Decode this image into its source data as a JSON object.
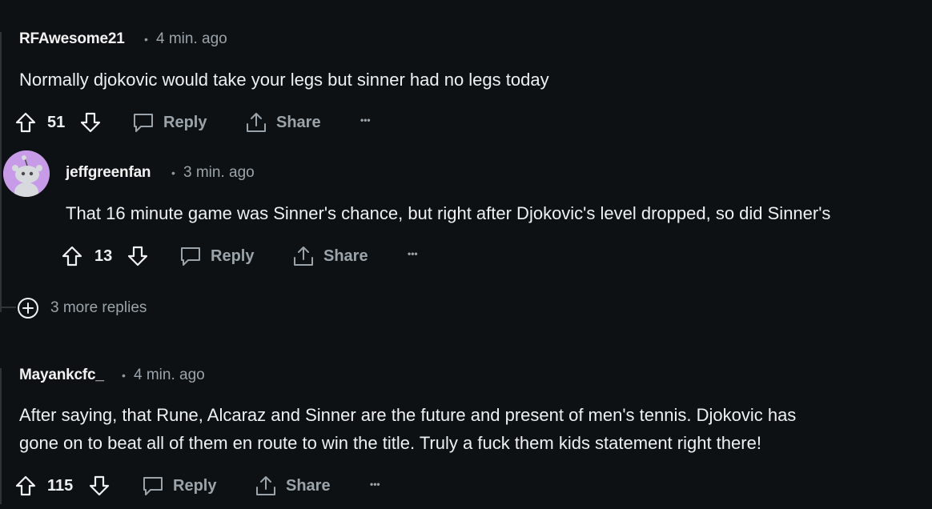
{
  "comments": [
    {
      "author": "RFAwesome21",
      "separator": "•",
      "time": "4 min. ago",
      "body": [
        "Normally djokovic would take your legs but sinner had no legs today"
      ],
      "score": "51",
      "reply_label": "Reply",
      "share_label": "Share",
      "more_label": "•••"
    },
    {
      "author": "jeffgreenfan",
      "separator": "•",
      "time": "3 min. ago",
      "body": [
        "That 16 minute game was Sinner's chance, but right after Djokovic's level dropped, so did Sinner's"
      ],
      "score": "13",
      "reply_label": "Reply",
      "share_label": "Share",
      "more_label": "•••"
    },
    {
      "author": "Mayankcfc_",
      "separator": "•",
      "time": "4 min. ago",
      "body": [
        "After saying, that Rune, Alcaraz and Sinner are the future and present of men's tennis. Djokovic has",
        "gone on to beat all of them en route to win the title. Truly a fuck them kids statement right there!"
      ],
      "score": "115",
      "reply_label": "Reply",
      "share_label": "Share",
      "more_label": "•••"
    }
  ],
  "more_replies": {
    "label": "3 more replies",
    "icon": "plus-circle-icon"
  },
  "icons": {
    "upvote": "arrow-up-icon",
    "downvote": "arrow-down-icon",
    "reply": "speech-bubble-icon",
    "share": "share-upload-icon",
    "more": "ellipsis-icon",
    "avatar": "snoo-avatar-icon"
  },
  "colors": {
    "background": "#0e1113",
    "text": "#eef1f3",
    "muted": "#9aa4aa",
    "avatar_bg": "#c79be8"
  }
}
